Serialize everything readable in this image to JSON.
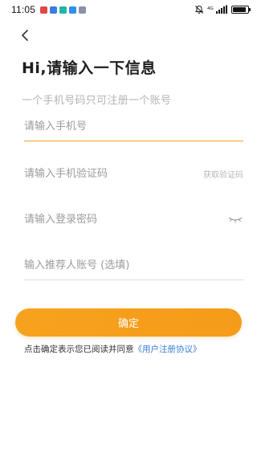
{
  "status_bar": {
    "time": "11:05",
    "notification_icons": [
      {
        "name": "app-notification-icon",
        "color": "#e04848"
      },
      {
        "name": "app-notification-icon",
        "color": "#3c7be0"
      },
      {
        "name": "app-notification-icon",
        "color": "#1fb6a8"
      },
      {
        "name": "app-notification-icon",
        "color": "#2f8fe8"
      },
      {
        "name": "app-notification-icon",
        "color": "#8a93a6"
      }
    ],
    "network_label": "4G"
  },
  "header": {
    "title": "Hi,请输入一下信息",
    "subtitle": "一个手机号码只可注册一个账号"
  },
  "form": {
    "phone_placeholder": "请输入手机号",
    "code_placeholder": "请输入手机验证码",
    "get_code_label": "获取验证码",
    "password_placeholder": "请输入登录密码",
    "referrer_placeholder": "输入推荐人账号 (选填)"
  },
  "actions": {
    "confirm_label": "确定"
  },
  "agreement": {
    "prefix": "点击确定表示您已阅读并同意",
    "link_text": "《用户注册协议》"
  },
  "colors": {
    "accent": "#f5a623",
    "link": "#3b7fd8",
    "placeholder": "#9b9b9b"
  }
}
